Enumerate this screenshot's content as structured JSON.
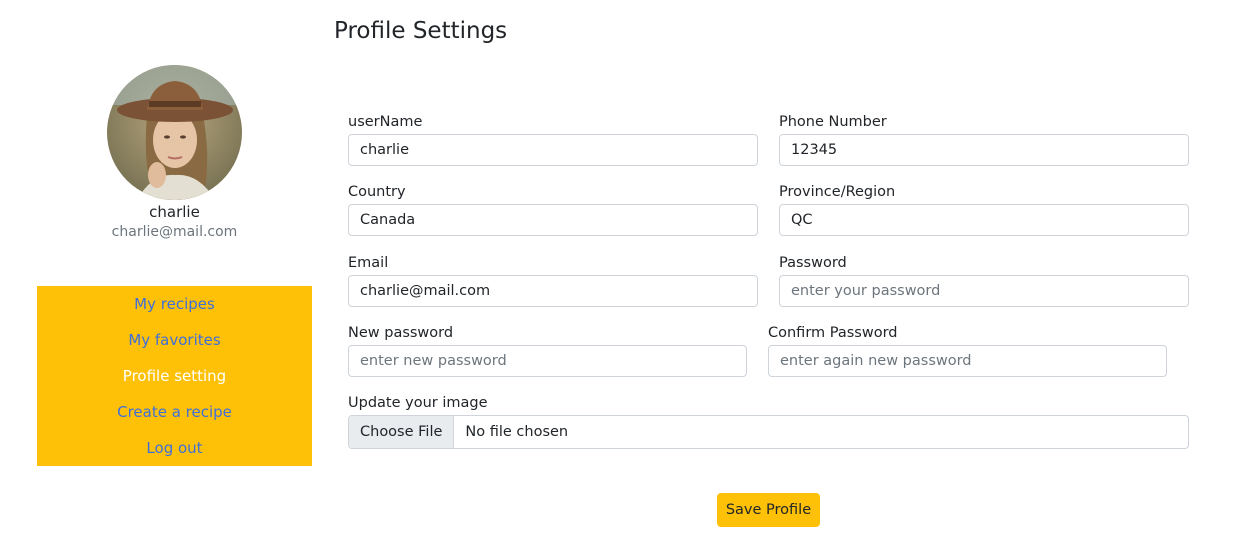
{
  "page": {
    "title": "Profile Settings"
  },
  "profile": {
    "name": "charlie",
    "email": "charlie@mail.com"
  },
  "sidebar": {
    "items": [
      {
        "label": "My recipes"
      },
      {
        "label": "My favorites"
      },
      {
        "label": "Profile setting",
        "active": true
      },
      {
        "label": "Create a recipe"
      },
      {
        "label": "Log out"
      }
    ]
  },
  "form": {
    "username": {
      "label": "userName",
      "value": "charlie",
      "placeholder": ""
    },
    "phone": {
      "label": "Phone Number",
      "value": "12345",
      "placeholder": ""
    },
    "country": {
      "label": "Country",
      "value": "Canada",
      "placeholder": ""
    },
    "province": {
      "label": "Province/Region",
      "value": "QC",
      "placeholder": ""
    },
    "email": {
      "label": "Email",
      "value": "charlie@mail.com",
      "placeholder": ""
    },
    "password": {
      "label": "Password",
      "value": "",
      "placeholder": "enter your password"
    },
    "new_password": {
      "label": "New password",
      "value": "",
      "placeholder": "enter new password"
    },
    "confirm_password": {
      "label": "Confirm Password",
      "value": "",
      "placeholder": "enter again new password"
    },
    "image": {
      "label": "Update your image",
      "button": "Choose File",
      "status": "No file chosen"
    },
    "save_label": "Save Profile"
  },
  "colors": {
    "accent": "#ffc107",
    "link": "#3f6fd9",
    "active_text": "#ffffff"
  }
}
